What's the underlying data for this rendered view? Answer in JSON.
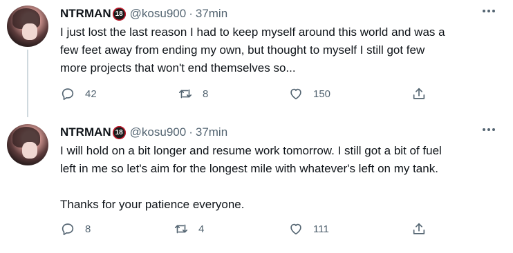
{
  "tweets": [
    {
      "author": "NTRMAN",
      "badge": "18",
      "handle": "@kosu900",
      "separator": "·",
      "time": "37min",
      "text": [
        "I just lost the last reason I had to keep myself around this world and was a",
        "few feet away from ending my own, but thought to myself I still got few",
        "more projects that won't end themselves so..."
      ],
      "replies": "42",
      "retweets": "8",
      "likes": "150"
    },
    {
      "author": "NTRMAN",
      "badge": "18",
      "handle": "@kosu900",
      "separator": "·",
      "time": "37min",
      "text": [
        "I will hold on a bit longer and resume work tomorrow. I still got a bit of fuel",
        "left in me so let's aim for the longest mile with whatever's left on my tank.",
        "Thanks for your patience everyone."
      ],
      "replies": "8",
      "retweets": "4",
      "likes": "111"
    }
  ],
  "icons": {
    "reply": "reply-icon",
    "retweet": "retweet-icon",
    "like": "heart-icon",
    "share": "share-icon",
    "more": "more-icon"
  },
  "colors": {
    "text": "#0f1419",
    "muted": "#536471",
    "thread_line": "#cfd9de"
  }
}
